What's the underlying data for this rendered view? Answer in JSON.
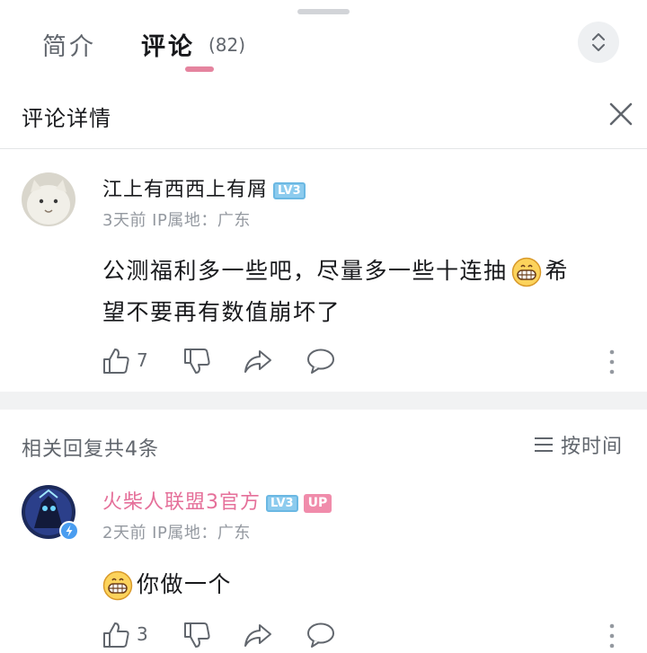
{
  "tabs": {
    "intro_label": "简介",
    "comments_label": "评论",
    "comments_count": "(82)"
  },
  "detail": {
    "title": "评论详情"
  },
  "main_comment": {
    "username": "江上有西西上有屑",
    "level": "LV3",
    "meta": "3天前  IP属地：广东",
    "text_before_emoji": "公测福利多一些吧，尽量多一些十连抽",
    "emoji": "grinning-face-emoji",
    "text_line1_after_emoji": "希",
    "text_line2": "望不要再有数值崩坏了",
    "likes": "7"
  },
  "replies": {
    "header": "相关回复共4条",
    "sort_label": "按时间"
  },
  "reply_comment": {
    "username": "火柴人联盟3官方",
    "level": "LV3",
    "up_badge": "UP",
    "meta": "2天前  IP属地：广东",
    "emoji": "grinning-face-emoji",
    "text_after_emoji": "你做一个",
    "likes": "3"
  },
  "colors": {
    "accent_pink": "#e5849f",
    "official_name": "#e5709a",
    "level_blue": "#8ccbee",
    "muted_text": "#9499a0"
  }
}
